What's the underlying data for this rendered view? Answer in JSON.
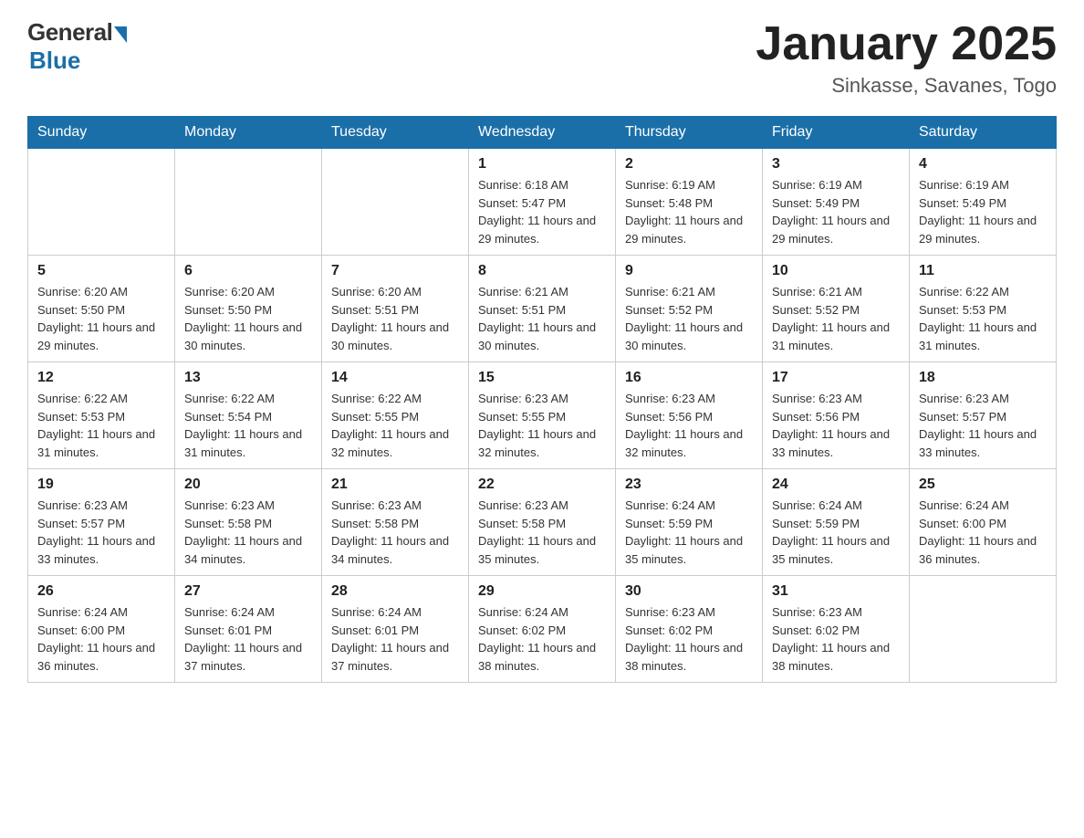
{
  "header": {
    "logo_general": "General",
    "logo_blue": "Blue",
    "title": "January 2025",
    "location": "Sinkasse, Savanes, Togo"
  },
  "days_of_week": [
    "Sunday",
    "Monday",
    "Tuesday",
    "Wednesday",
    "Thursday",
    "Friday",
    "Saturday"
  ],
  "weeks": [
    [
      {
        "day": "",
        "info": ""
      },
      {
        "day": "",
        "info": ""
      },
      {
        "day": "",
        "info": ""
      },
      {
        "day": "1",
        "info": "Sunrise: 6:18 AM\nSunset: 5:47 PM\nDaylight: 11 hours and 29 minutes."
      },
      {
        "day": "2",
        "info": "Sunrise: 6:19 AM\nSunset: 5:48 PM\nDaylight: 11 hours and 29 minutes."
      },
      {
        "day": "3",
        "info": "Sunrise: 6:19 AM\nSunset: 5:49 PM\nDaylight: 11 hours and 29 minutes."
      },
      {
        "day": "4",
        "info": "Sunrise: 6:19 AM\nSunset: 5:49 PM\nDaylight: 11 hours and 29 minutes."
      }
    ],
    [
      {
        "day": "5",
        "info": "Sunrise: 6:20 AM\nSunset: 5:50 PM\nDaylight: 11 hours and 29 minutes."
      },
      {
        "day": "6",
        "info": "Sunrise: 6:20 AM\nSunset: 5:50 PM\nDaylight: 11 hours and 30 minutes."
      },
      {
        "day": "7",
        "info": "Sunrise: 6:20 AM\nSunset: 5:51 PM\nDaylight: 11 hours and 30 minutes."
      },
      {
        "day": "8",
        "info": "Sunrise: 6:21 AM\nSunset: 5:51 PM\nDaylight: 11 hours and 30 minutes."
      },
      {
        "day": "9",
        "info": "Sunrise: 6:21 AM\nSunset: 5:52 PM\nDaylight: 11 hours and 30 minutes."
      },
      {
        "day": "10",
        "info": "Sunrise: 6:21 AM\nSunset: 5:52 PM\nDaylight: 11 hours and 31 minutes."
      },
      {
        "day": "11",
        "info": "Sunrise: 6:22 AM\nSunset: 5:53 PM\nDaylight: 11 hours and 31 minutes."
      }
    ],
    [
      {
        "day": "12",
        "info": "Sunrise: 6:22 AM\nSunset: 5:53 PM\nDaylight: 11 hours and 31 minutes."
      },
      {
        "day": "13",
        "info": "Sunrise: 6:22 AM\nSunset: 5:54 PM\nDaylight: 11 hours and 31 minutes."
      },
      {
        "day": "14",
        "info": "Sunrise: 6:22 AM\nSunset: 5:55 PM\nDaylight: 11 hours and 32 minutes."
      },
      {
        "day": "15",
        "info": "Sunrise: 6:23 AM\nSunset: 5:55 PM\nDaylight: 11 hours and 32 minutes."
      },
      {
        "day": "16",
        "info": "Sunrise: 6:23 AM\nSunset: 5:56 PM\nDaylight: 11 hours and 32 minutes."
      },
      {
        "day": "17",
        "info": "Sunrise: 6:23 AM\nSunset: 5:56 PM\nDaylight: 11 hours and 33 minutes."
      },
      {
        "day": "18",
        "info": "Sunrise: 6:23 AM\nSunset: 5:57 PM\nDaylight: 11 hours and 33 minutes."
      }
    ],
    [
      {
        "day": "19",
        "info": "Sunrise: 6:23 AM\nSunset: 5:57 PM\nDaylight: 11 hours and 33 minutes."
      },
      {
        "day": "20",
        "info": "Sunrise: 6:23 AM\nSunset: 5:58 PM\nDaylight: 11 hours and 34 minutes."
      },
      {
        "day": "21",
        "info": "Sunrise: 6:23 AM\nSunset: 5:58 PM\nDaylight: 11 hours and 34 minutes."
      },
      {
        "day": "22",
        "info": "Sunrise: 6:23 AM\nSunset: 5:58 PM\nDaylight: 11 hours and 35 minutes."
      },
      {
        "day": "23",
        "info": "Sunrise: 6:24 AM\nSunset: 5:59 PM\nDaylight: 11 hours and 35 minutes."
      },
      {
        "day": "24",
        "info": "Sunrise: 6:24 AM\nSunset: 5:59 PM\nDaylight: 11 hours and 35 minutes."
      },
      {
        "day": "25",
        "info": "Sunrise: 6:24 AM\nSunset: 6:00 PM\nDaylight: 11 hours and 36 minutes."
      }
    ],
    [
      {
        "day": "26",
        "info": "Sunrise: 6:24 AM\nSunset: 6:00 PM\nDaylight: 11 hours and 36 minutes."
      },
      {
        "day": "27",
        "info": "Sunrise: 6:24 AM\nSunset: 6:01 PM\nDaylight: 11 hours and 37 minutes."
      },
      {
        "day": "28",
        "info": "Sunrise: 6:24 AM\nSunset: 6:01 PM\nDaylight: 11 hours and 37 minutes."
      },
      {
        "day": "29",
        "info": "Sunrise: 6:24 AM\nSunset: 6:02 PM\nDaylight: 11 hours and 38 minutes."
      },
      {
        "day": "30",
        "info": "Sunrise: 6:23 AM\nSunset: 6:02 PM\nDaylight: 11 hours and 38 minutes."
      },
      {
        "day": "31",
        "info": "Sunrise: 6:23 AM\nSunset: 6:02 PM\nDaylight: 11 hours and 38 minutes."
      },
      {
        "day": "",
        "info": ""
      }
    ]
  ]
}
